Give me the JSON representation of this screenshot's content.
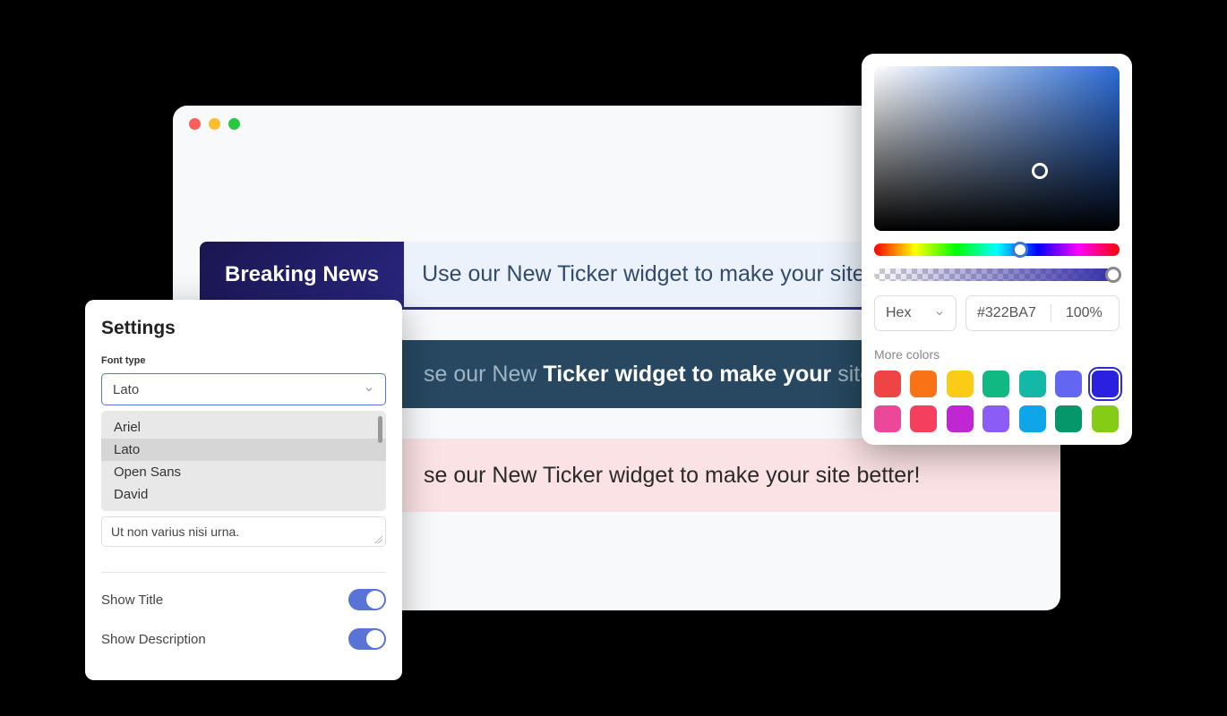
{
  "browser": {
    "ticker1": {
      "badge": "Breaking News",
      "text": "Use our New Ticker widget to make your site be"
    },
    "ticker2": {
      "pre": "se our New ",
      "bold": "Ticker widget to make your",
      "post": " site be"
    },
    "ticker3": {
      "text": "se our New Ticker widget to make your site better!"
    }
  },
  "settings": {
    "title": "Settings",
    "font_type_label": "Font type",
    "selected_font": "Lato",
    "font_options": [
      "Ariel",
      "Lato",
      "Open Sans",
      "David"
    ],
    "textarea_value": "Ut non varius nisi urna.",
    "show_title_label": "Show Title",
    "show_description_label": "Show Description"
  },
  "picker": {
    "format_label": "Hex",
    "hex_value": "#322BA7",
    "opacity": "100%",
    "more_label": "More colors",
    "swatches": [
      {
        "color": "#ef4444"
      },
      {
        "color": "#f97316"
      },
      {
        "color": "#facc15"
      },
      {
        "color": "#10b981"
      },
      {
        "color": "#14b8a6"
      },
      {
        "color": "#6366f1"
      },
      {
        "color": "#2a20e0",
        "active": true
      },
      {
        "color": "#ec4899"
      },
      {
        "color": "#f43f5e"
      },
      {
        "color": "#c026d3"
      },
      {
        "color": "#8b5cf6"
      },
      {
        "color": "#0ea5e9"
      },
      {
        "color": "#059669"
      },
      {
        "color": "#84cc16"
      }
    ]
  }
}
